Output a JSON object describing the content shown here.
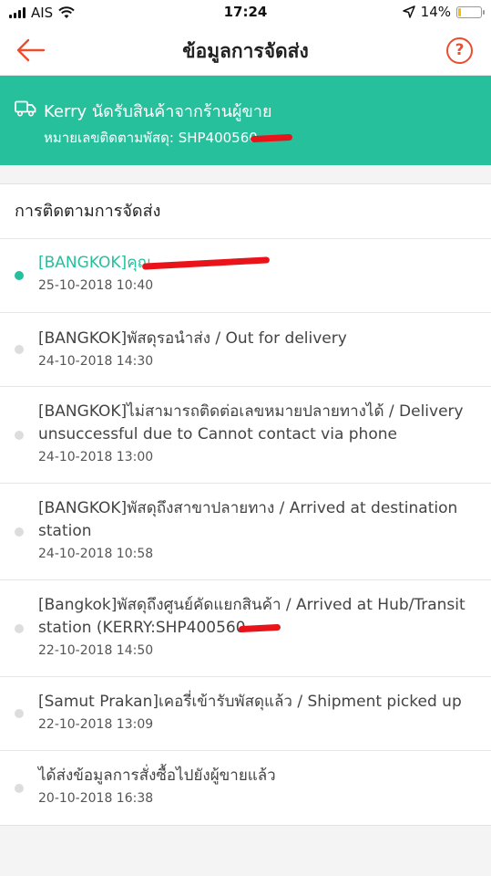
{
  "status_bar": {
    "carrier": "AIS",
    "time": "17:24",
    "battery": "14%",
    "battery_level": 0.14
  },
  "header": {
    "title": "ข้อมูลการจัดส่ง",
    "help_label": "?"
  },
  "courier": {
    "line1": "Kerry นัดรับสินค้าจากร้านผู้ขาย",
    "line2": "หมายเลขติดตามพัสดุ: SHP400560"
  },
  "tracking": {
    "section_title": "การติดตามการจัดส่ง",
    "events": [
      {
        "text": "[BANGKOK]คุณ",
        "time": "25-10-2018 10:40"
      },
      {
        "text": "[BANGKOK]พัสดุรอนำส่ง / Out for delivery",
        "time": "24-10-2018 14:30"
      },
      {
        "text": "[BANGKOK]ไม่สามารถติดต่อเลขหมายปลายทางได้ / Delivery unsuccessful due to Cannot contact via phone",
        "time": "24-10-2018 13:00"
      },
      {
        "text": "[BANGKOK]พัสดุถึงสาขาปลายทาง / Arrived at destination station",
        "time": "24-10-2018 10:58"
      },
      {
        "text": "[Bangkok]พัสดุถึงศูนย์คัดแยกสินค้า / Arrived at Hub/Transit station (KERRY:SHP400560",
        "time": "22-10-2018 14:50"
      },
      {
        "text": "[Samut Prakan]เคอรี่เข้ารับพัสดุแล้ว / Shipment picked up",
        "time": "22-10-2018 13:09"
      },
      {
        "text": "ได้ส่งข้อมูลการสั่งซื้อไปยังผู้ขายแล้ว",
        "time": "20-10-2018 16:38"
      }
    ]
  },
  "colors": {
    "accent": "#ee4d2d",
    "teal": "#26c09d",
    "redaction": "#e8141a"
  }
}
